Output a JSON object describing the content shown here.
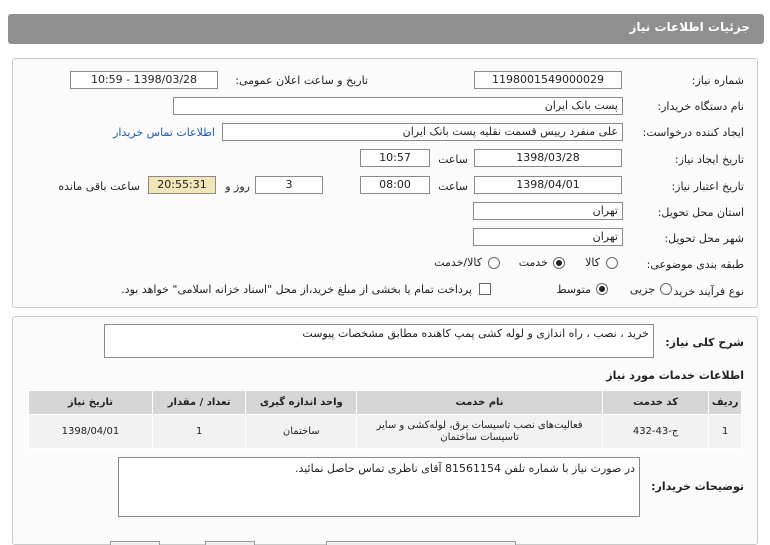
{
  "header": {
    "title": "جزئیات اطلاعات نیاز"
  },
  "form": {
    "need_number_label": "شماره نیاز:",
    "need_number": "1198001549000029",
    "announce_label": "تاریخ و ساعت اعلان عمومی:",
    "announce_value": "1398/03/28 - 10:59",
    "buyer_org_label": "نام دستگاه خریدار:",
    "buyer_org": "پست بانک ایران",
    "requester_label": "ایجاد کننده درخواست:",
    "requester": "علی منفرد رییس قسمت نقلیه پست بانک ایران",
    "contact_link": "اطلاعات تماس خریدار",
    "created_label": "تاریخ ایجاد نیاز:",
    "created_date": "1398/03/28",
    "time_label": "ساعت",
    "created_time": "10:57",
    "valid_label": "تاریخ اعتبار نیاز:",
    "valid_date": "1398/04/01",
    "valid_time": "08:00",
    "days_value": "3",
    "days_label": "روز و",
    "remaining_time": "20:55:31",
    "remaining_label": "ساعت باقی مانده",
    "province_label": "استان محل تحویل:",
    "province": "تهران",
    "city_label": "شهر محل تحویل:",
    "city": "تهران",
    "category_label": "طبقه بندی موضوعی:",
    "category_options": [
      "کالا",
      "خدمت",
      "کالا/خدمت"
    ],
    "purchase_label": "نوع فرآیند خرید :",
    "purchase_options": [
      "جزیی",
      "متوسط"
    ],
    "payment_note": "پرداخت تمام یا بخشی از مبلغ خرید،از محل \"اسناد خزانه اسلامی\" خواهد بود."
  },
  "summary": {
    "label": "شرح کلی نیاز:",
    "value": "خرید ، نصب ، راه اندازی و لوله کشی پمپ کاهنده مطابق مشخصات پیوست"
  },
  "services": {
    "section_title": "اطلاعات خدمات مورد نیاز",
    "headers": [
      "ردیف",
      "کد خدمت",
      "نام خدمت",
      "واحد اندازه گیری",
      "تعداد / مقدار",
      "تاریخ نیاز"
    ],
    "rows": [
      [
        "1",
        "ج-43-432",
        "فعالیت‌های نصب تاسیسات برق، لوله‌کشی و سایر تاسیسات ساختمان",
        "ساختمان",
        "1",
        "1398/04/01"
      ]
    ]
  },
  "buyer_notes": {
    "label": "توضیحات خریدار:",
    "value": "در صورت نیاز با شماره تلفن 81561154 آقای ناظری تماس حاصل نمائید."
  }
}
